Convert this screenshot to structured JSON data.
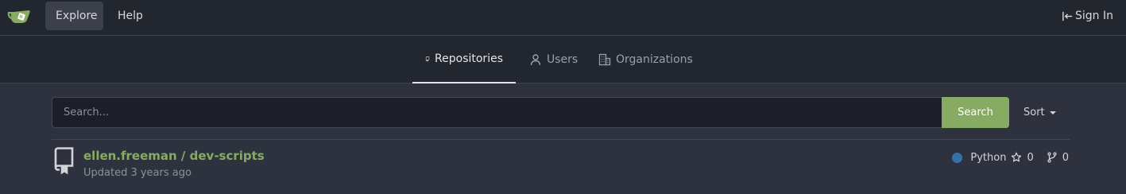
{
  "navbar": {
    "explore_label": "Explore",
    "help_label": "Help",
    "signin_label": "Sign In"
  },
  "tabs": [
    {
      "label": "Repositories",
      "active": true
    },
    {
      "label": "Users",
      "active": false
    },
    {
      "label": "Organizations",
      "active": false
    }
  ],
  "search": {
    "placeholder": "Search...",
    "value": "",
    "button_label": "Search"
  },
  "sort": {
    "label": "Sort"
  },
  "repos": [
    {
      "full_name": "ellen.freeman / dev-scripts",
      "updated": "Updated 3 years ago",
      "language": "Python",
      "language_color": "#3572a5",
      "stars": "0",
      "forks": "0"
    }
  ],
  "colors": {
    "accent": "#87ab63",
    "navbar_bg": "#22262f",
    "page_bg": "#2e323e"
  }
}
